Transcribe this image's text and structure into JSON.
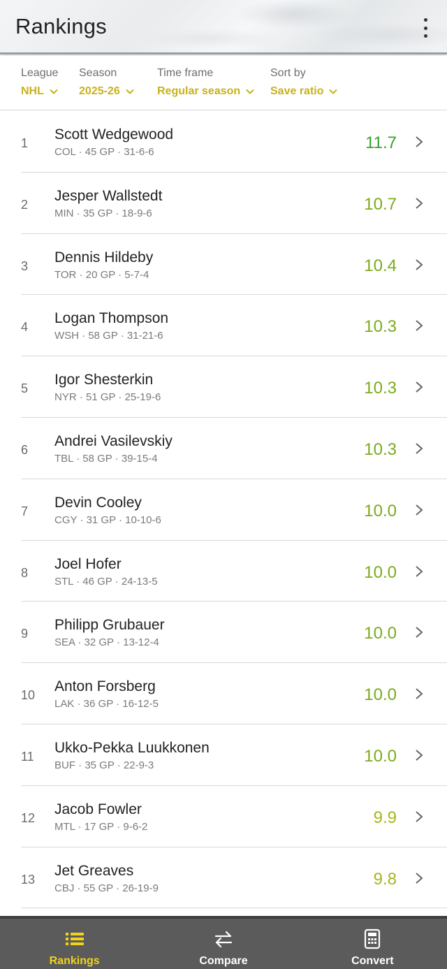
{
  "header": {
    "title": "Rankings"
  },
  "filters": [
    {
      "label": "League",
      "value": "NHL"
    },
    {
      "label": "Season",
      "value": "2025-26"
    },
    {
      "label": "Time frame",
      "value": "Regular season"
    },
    {
      "label": "Sort by",
      "value": "Save ratio"
    }
  ],
  "rows": [
    {
      "rank": "1",
      "name": "Scott Wedgewood",
      "meta": "COL · 45 GP · 31-6-6",
      "value": "11.7"
    },
    {
      "rank": "2",
      "name": "Jesper Wallstedt",
      "meta": "MIN · 35 GP · 18-9-6",
      "value": "10.7"
    },
    {
      "rank": "3",
      "name": "Dennis Hildeby",
      "meta": "TOR · 20 GP · 5-7-4",
      "value": "10.4"
    },
    {
      "rank": "4",
      "name": "Logan Thompson",
      "meta": "WSH · 58 GP · 31-21-6",
      "value": "10.3"
    },
    {
      "rank": "5",
      "name": "Igor Shesterkin",
      "meta": "NYR · 51 GP · 25-19-6",
      "value": "10.3"
    },
    {
      "rank": "6",
      "name": "Andrei Vasilevskiy",
      "meta": "TBL · 58 GP · 39-15-4",
      "value": "10.3"
    },
    {
      "rank": "7",
      "name": "Devin Cooley",
      "meta": "CGY · 31 GP · 10-10-6",
      "value": "10.0"
    },
    {
      "rank": "8",
      "name": "Joel Hofer",
      "meta": "STL · 46 GP · 24-13-5",
      "value": "10.0"
    },
    {
      "rank": "9",
      "name": "Philipp Grubauer",
      "meta": "SEA · 32 GP · 13-12-4",
      "value": "10.0"
    },
    {
      "rank": "10",
      "name": "Anton Forsberg",
      "meta": "LAK · 36 GP · 16-12-5",
      "value": "10.0"
    },
    {
      "rank": "11",
      "name": "Ukko-Pekka Luukkonen",
      "meta": "BUF · 35 GP · 22-9-3",
      "value": "10.0"
    },
    {
      "rank": "12",
      "name": "Jacob Fowler",
      "meta": "MTL · 17 GP · 9-6-2",
      "value": "9.9"
    },
    {
      "rank": "13",
      "name": "Jet Greaves",
      "meta": "CBJ · 55 GP · 26-19-9",
      "value": "9.8"
    }
  ],
  "nav": [
    {
      "label": "Rankings",
      "icon": "list-icon",
      "active": true
    },
    {
      "label": "Compare",
      "icon": "swap-arrows-icon",
      "active": false
    },
    {
      "label": "Convert",
      "icon": "calculator-icon",
      "active": false
    }
  ],
  "colors": {
    "accent": "#c7b21a",
    "nav_active": "#f2d21a",
    "value_green": "#38a02e",
    "value_olive": "#7cab1b",
    "nav_bg": "#5b5b5b"
  }
}
